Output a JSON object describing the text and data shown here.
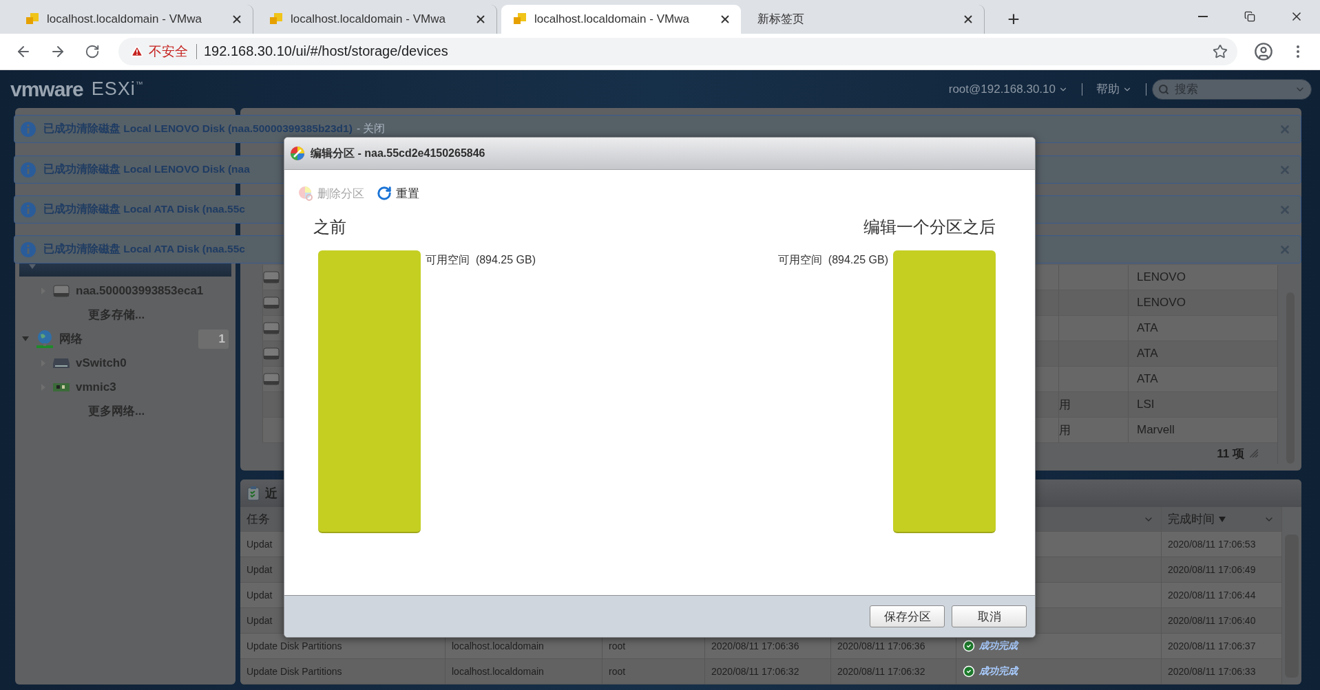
{
  "browser": {
    "tabs": [
      {
        "title": "localhost.localdomain - VMwa",
        "selected": false,
        "kind": "site"
      },
      {
        "title": "localhost.localdomain - VMwa",
        "selected": false,
        "kind": "site"
      },
      {
        "title": "localhost.localdomain - VMwa",
        "selected": true,
        "kind": "site"
      },
      {
        "title": "新标签页",
        "selected": false,
        "kind": "blank"
      }
    ],
    "new_tab": "+",
    "security": "不安全",
    "url": "192.168.30.10/ui/#/host/storage/devices"
  },
  "header": {
    "logo": "vmware",
    "product": "ESXi",
    "tm": "™",
    "user": "root@192.168.30.10",
    "help": "帮助",
    "search": {
      "placeholder": "搜索"
    }
  },
  "notifications": [
    {
      "message": "已成功清除磁盘 Local LENOVO Disk (naa.50000399385b23d1)",
      "link": "- 关闭"
    },
    {
      "message": "已成功清除磁盘 Local LENOVO Disk (naa"
    },
    {
      "message": "已成功清除磁盘 Local ATA Disk (naa.55c"
    },
    {
      "message": "已成功清除磁盘 Local ATA Disk (naa.55c"
    }
  ],
  "sidebar": {
    "items": [
      {
        "kind": "section",
        "expanded": true,
        "children": [
          {
            "label": "naa.500003993853eca1",
            "kind": "disk",
            "expanded": false
          },
          {
            "label": "更多存储...",
            "kind": "more"
          }
        ]
      },
      {
        "label": "网络",
        "kind": "network",
        "expanded": true,
        "badge": "1",
        "children": [
          {
            "label": "vSwitch0",
            "kind": "switch",
            "expanded": false
          },
          {
            "label": "vmnic3",
            "kind": "nic",
            "expanded": false
          },
          {
            "label": "更多网络...",
            "kind": "more"
          }
        ]
      }
    ]
  },
  "devices": {
    "rows": [
      {
        "icon": true,
        "vendor": "LENOVO"
      },
      {
        "icon": true,
        "vendor": "LENOVO"
      },
      {
        "icon": true,
        "vendor": "ATA"
      },
      {
        "icon": true,
        "vendor": "ATA"
      },
      {
        "icon": true,
        "vendor": "ATA"
      },
      {
        "icon": false,
        "status": "用",
        "vendor": "LSI"
      },
      {
        "icon": false,
        "status": "用",
        "vendor": "Marvell"
      }
    ],
    "count": "11 项"
  },
  "tasks": {
    "title": "近",
    "columns": [
      {
        "label": "任务"
      },
      {
        "menu": true
      },
      {
        "label": "完成时间",
        "sorted": true,
        "menu": true
      }
    ],
    "rows": [
      {
        "task": "Updat",
        "completed": "2020/08/11 17:06:53"
      },
      {
        "task": "Updat",
        "completed": "2020/08/11 17:06:49"
      },
      {
        "task": "Updat",
        "completed": "2020/08/11 17:06:44"
      },
      {
        "task": "Updat",
        "completed": "2020/08/11 17:06:40"
      },
      {
        "task": "Update Disk Partitions",
        "target": "localhost.localdomain",
        "initiator": "root",
        "queued": "2020/08/11 17:06:36",
        "started": "2020/08/11 17:06:36",
        "result": "成功完成",
        "completed": "2020/08/11 17:06:37"
      },
      {
        "task": "Update Disk Partitions",
        "target": "localhost.localdomain",
        "initiator": "root",
        "queued": "2020/08/11 17:06:32",
        "started": "2020/08/11 17:06:32",
        "result": "成功完成",
        "completed": "2020/08/11 17:06:33"
      }
    ]
  },
  "dialog": {
    "title": "编辑分区 - naa.55cd2e4150265846",
    "toolbar": [
      {
        "label": "删除分区",
        "kind": "delete",
        "disabled": true
      },
      {
        "label": "重置",
        "kind": "reset",
        "disabled": false
      }
    ],
    "before": {
      "heading": "之前",
      "partitions": [
        {
          "label": "可用空间",
          "size": "(894.25 GB)"
        }
      ]
    },
    "after": {
      "heading": "编辑一个分区之后",
      "partitions": [
        {
          "label": "可用空间",
          "size": "(894.25 GB)"
        }
      ]
    },
    "buttons": [
      "保存分区",
      "取消"
    ]
  }
}
